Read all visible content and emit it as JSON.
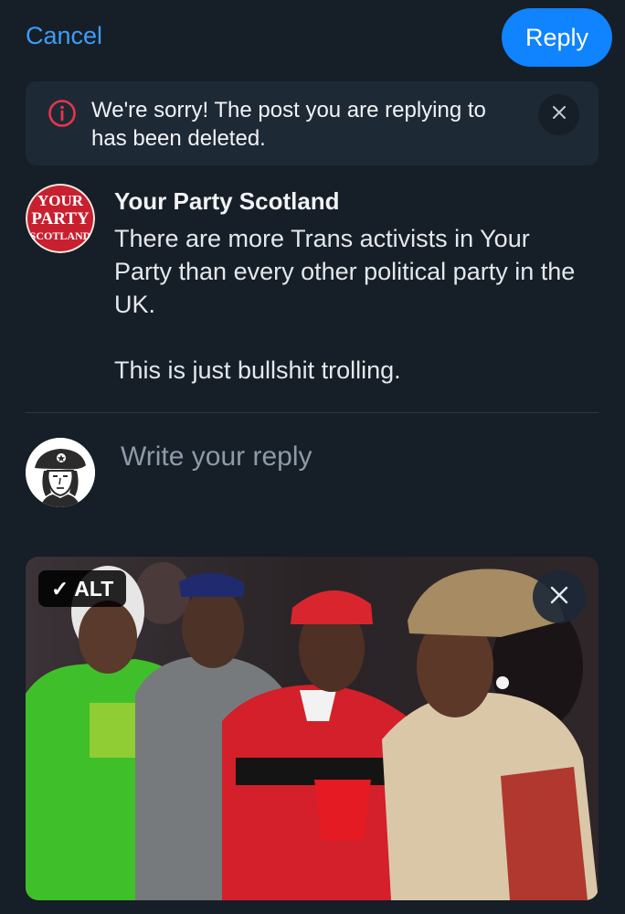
{
  "header": {
    "cancel_label": "Cancel",
    "reply_label": "Reply"
  },
  "banner": {
    "message": "We're sorry! The post you are replying to has been deleted."
  },
  "post": {
    "author": "Your Party Scotland",
    "avatar_text": [
      "YOUR",
      "PARTY",
      "SCOTLAND"
    ],
    "paragraphs": [
      "There are more Trans activists in Your Party than every other political party in the UK.",
      "This is just bullshit trolling."
    ]
  },
  "composer": {
    "placeholder": "Write your reply"
  },
  "media": {
    "alt_label": "ALT",
    "alt_check": "✓"
  },
  "colors": {
    "background": "#161e27",
    "accent": "#1083fe",
    "link": "#3f9cf6",
    "banner_bg": "#1e2936",
    "warning": "#e5364b"
  },
  "icons": {
    "banner": "info-circle-icon",
    "banner_close": "close-icon",
    "media_close": "close-icon",
    "alt": "checkmark-icon"
  }
}
